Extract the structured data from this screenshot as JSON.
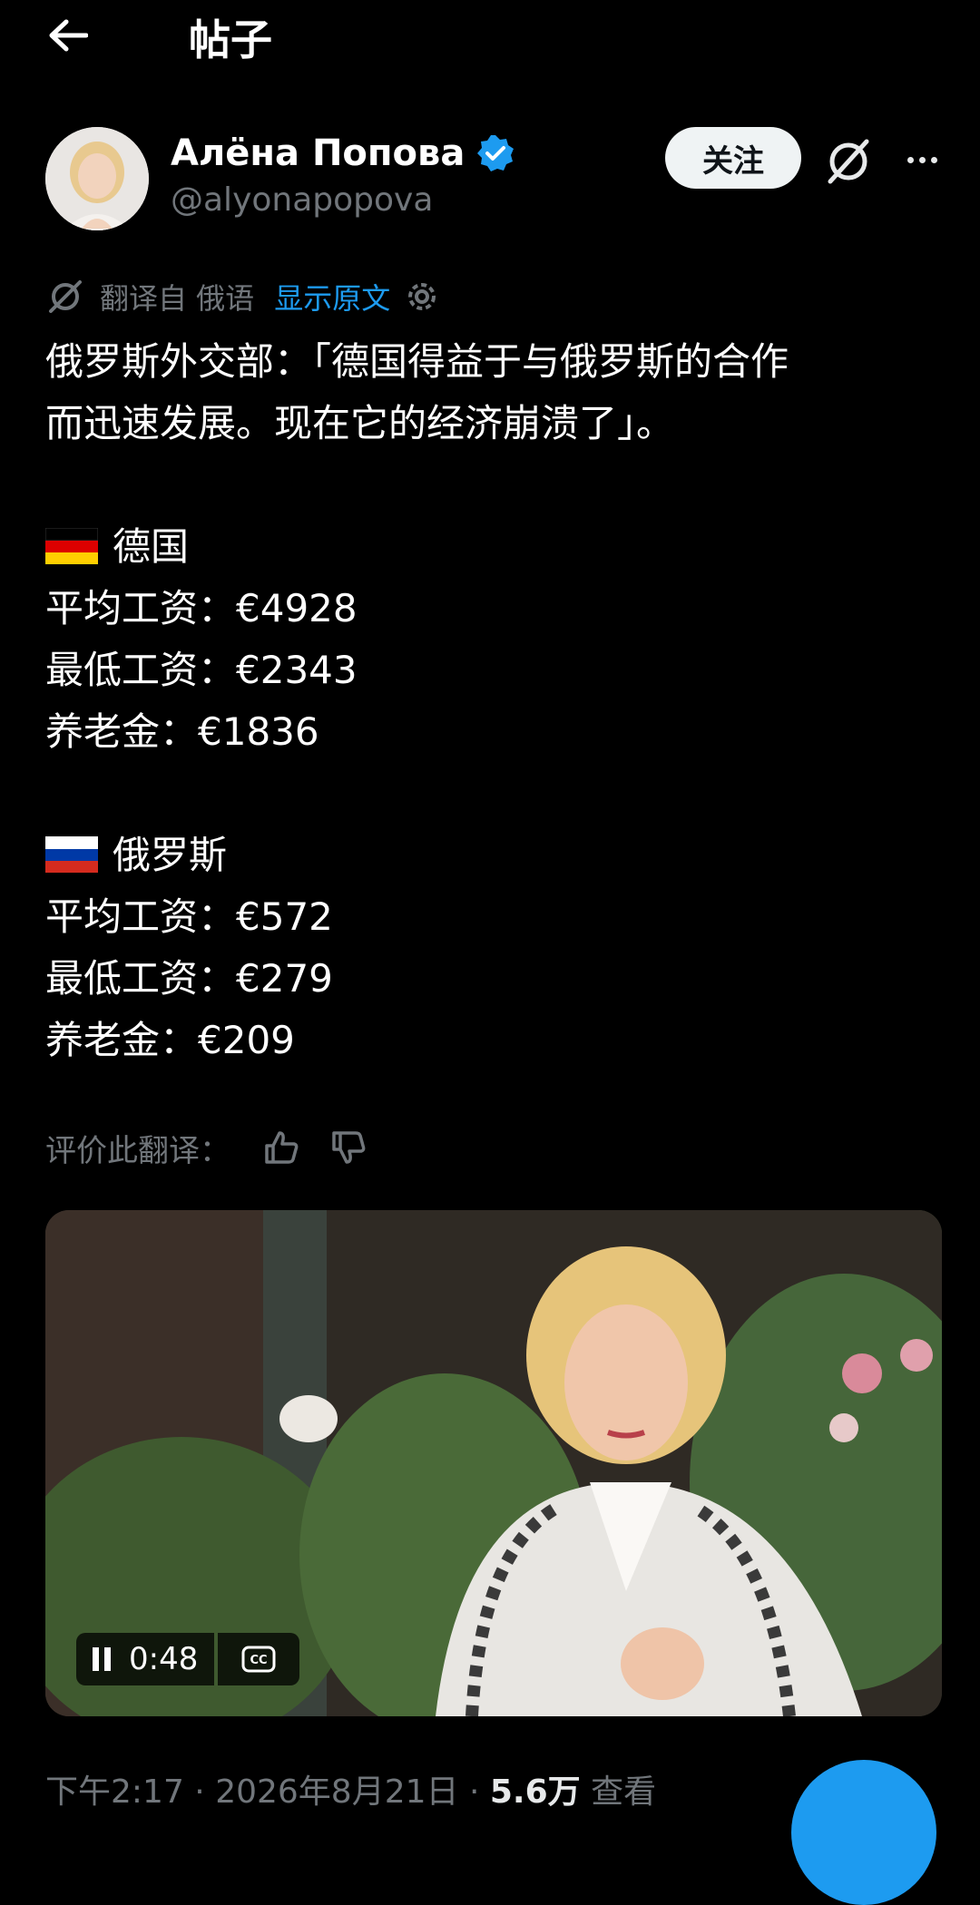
{
  "header": {
    "title": "帖子"
  },
  "author": {
    "name": "Алёна Попова",
    "handle": "@alyonapopova",
    "follow_label": "关注"
  },
  "translation": {
    "source": "翻译自 俄语",
    "show_original": "显示原文"
  },
  "post": {
    "lines": [
      "俄罗斯外交部：「德国得益于与俄罗斯的合作",
      "而迅速发展。现在它的经济崩溃了」。"
    ],
    "germany": {
      "country": "德国",
      "stats": [
        "平均工资：€4928",
        "最低工资：€2343",
        "养老金：€1836"
      ]
    },
    "russia": {
      "country": "俄罗斯",
      "stats": [
        "平均工资：€572",
        "最低工资：€279",
        "养老金：€209"
      ]
    }
  },
  "rating": {
    "label": "评价此翻译："
  },
  "video": {
    "time": "0:48"
  },
  "meta": {
    "time": "下午2:17",
    "date": "2026年8月21日",
    "views": "5.6万",
    "views_label": "查看"
  },
  "colors": {
    "accent": "#1d9bf0",
    "background": "#000000",
    "muted": "#71767b"
  }
}
